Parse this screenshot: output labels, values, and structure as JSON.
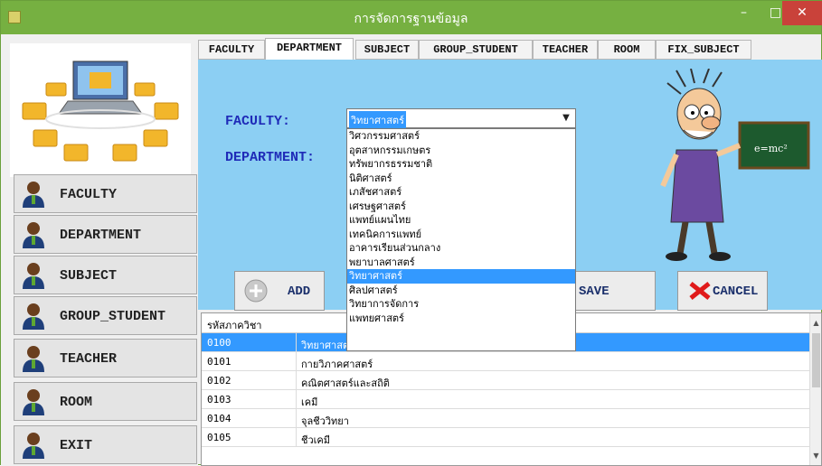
{
  "window": {
    "title": "การจัดการฐานข้อมูล",
    "minimize_label": "–",
    "maximize_label": "□",
    "close_label": "✕"
  },
  "sidebar": {
    "buttons": [
      {
        "label": "FACULTY"
      },
      {
        "label": "DEPARTMENT"
      },
      {
        "label": "SUBJECT"
      },
      {
        "label": "GROUP_STUDENT"
      },
      {
        "label": "TEACHER"
      },
      {
        "label": "ROOM"
      },
      {
        "label": "EXIT"
      }
    ]
  },
  "tabs": [
    {
      "label": "FACULTY"
    },
    {
      "label": "DEPARTMENT"
    },
    {
      "label": "SUBJECT"
    },
    {
      "label": "GROUP_STUDENT"
    },
    {
      "label": "TEACHER"
    },
    {
      "label": "ROOM"
    },
    {
      "label": "FIX_SUBJECT"
    }
  ],
  "active_tab": "DEPARTMENT",
  "form": {
    "faculty_label": "FACULTY:",
    "department_label": "DEPARTMENT:",
    "faculty_value": "วิทยาศาสตร์",
    "dropdown_options": [
      "วิศวกรรมศาสตร์",
      "อุตสาหกรรมเกษตร",
      "ทรัพยากรธรรมชาติ",
      "นิติศาสตร์",
      "เภสัชศาสตร์",
      "เศรษฐศาสตร์",
      "แพทย์แผนไทย",
      "เทคนิคการแพทย์",
      "อาคารเรียนส่วนกลาง",
      "พยาบาลศาสตร์",
      "วิทยาศาสตร์",
      "ศิลปศาสตร์",
      "วิทยาการจัดการ",
      "แพทยศาสตร์"
    ],
    "selected_option_index": 10
  },
  "actions": {
    "add_label": "ADD",
    "save_label": "SAVE",
    "cancel_label": "CANCEL"
  },
  "grid": {
    "columns": [
      "รหัสภาควิชา",
      ""
    ],
    "rows": [
      {
        "code": "0100",
        "name": "วิทยาศาสตร์"
      },
      {
        "code": "0101",
        "name": "กายวิภาคศาสตร์"
      },
      {
        "code": "0102",
        "name": "คณิตศาสตร์และสถิติ"
      },
      {
        "code": "0103",
        "name": "เคมี"
      },
      {
        "code": "0104",
        "name": "จุลชีววิทยา"
      },
      {
        "code": "0105",
        "name": "ชีวเคมี"
      }
    ],
    "selected_row_index": 0
  },
  "colors": {
    "titlebar": "#76b041",
    "panel": "#8ccff3",
    "label_blue": "#1f2bb8",
    "selection": "#3399ff",
    "close_button": "#c9423a"
  }
}
